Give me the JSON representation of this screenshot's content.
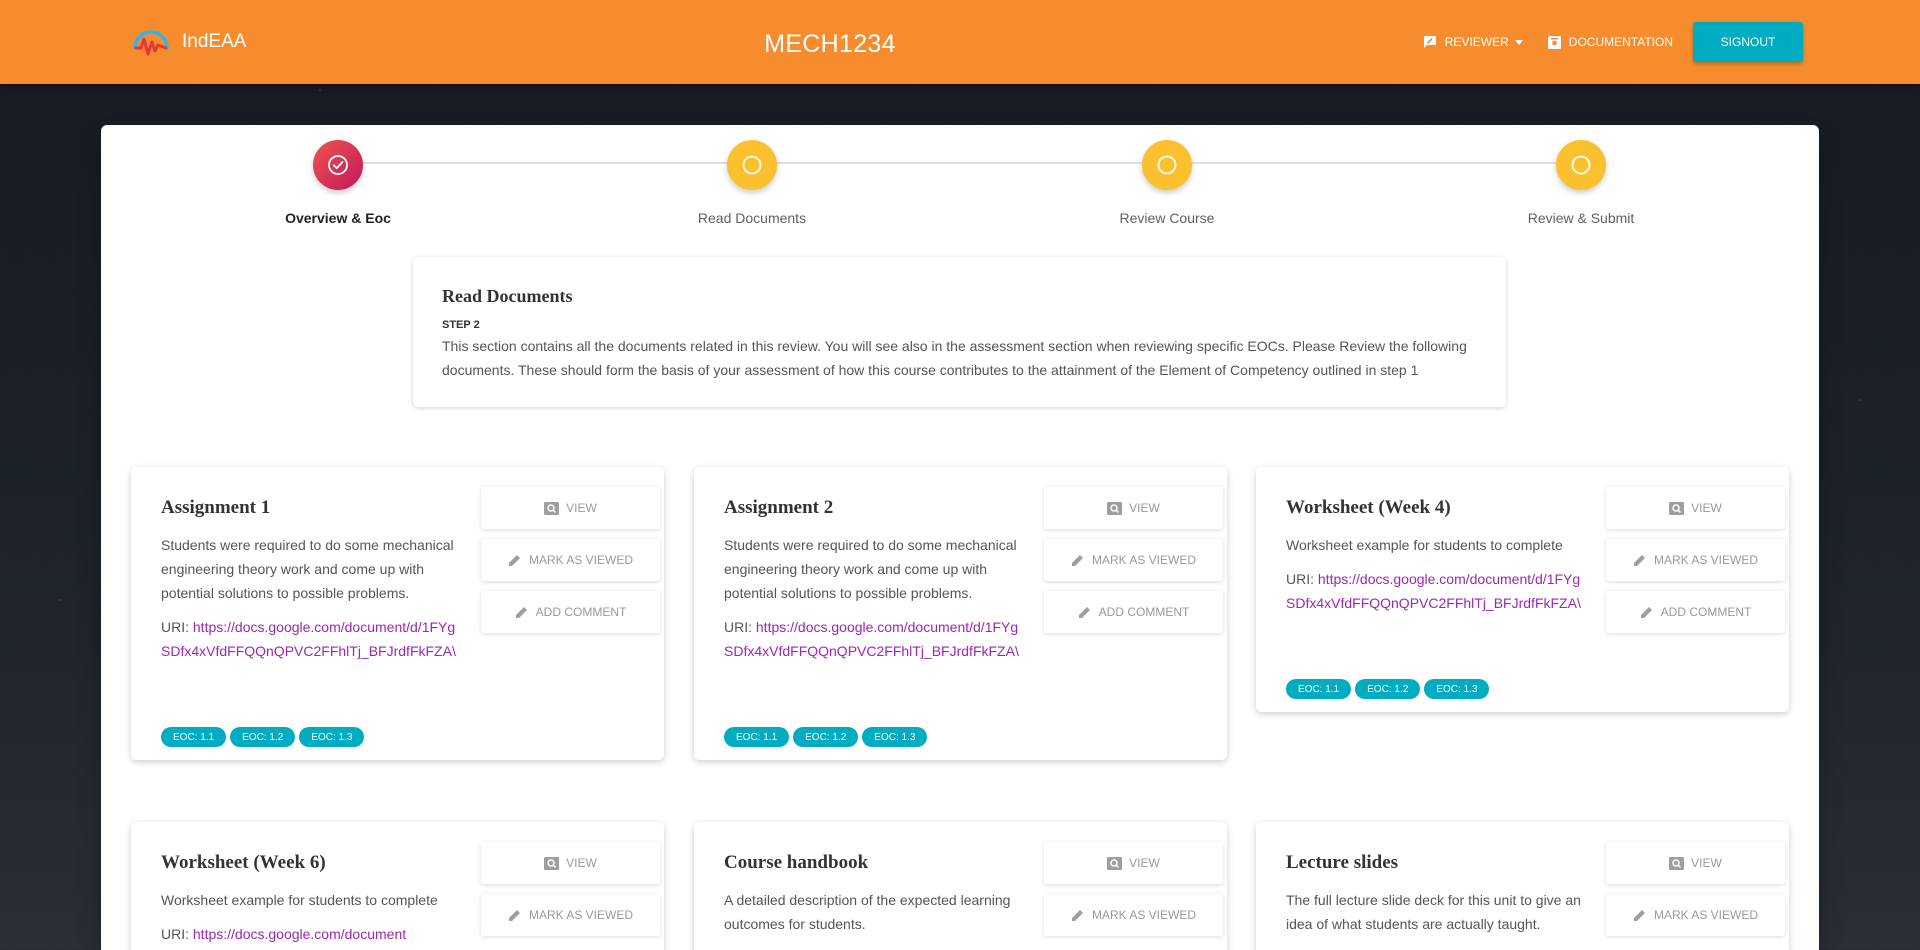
{
  "navbar": {
    "brand": "IndEAA",
    "title": "MECH1234",
    "reviewer_label": "REVIEWER",
    "documentation_label": "DOCUMENTATION",
    "signout_label": "SIGNOUT"
  },
  "stepper": {
    "steps": [
      {
        "label": "Overview & Eoc",
        "status": "done"
      },
      {
        "label": "Read Documents",
        "status": "todo"
      },
      {
        "label": "Review Course",
        "status": "todo"
      },
      {
        "label": "Review & Submit",
        "status": "todo"
      }
    ]
  },
  "info": {
    "title": "Read Documents",
    "step": "STEP 2",
    "text": "This section contains all the documents related in this review. You will see also in the assessment section when reviewing specific EOCs. Please Review the following documents. These should form the basis of your assessment of how this course contributes to the attainment of the Element of Competency outlined in step 1"
  },
  "actions": {
    "view": "VIEW",
    "mark": "MARK AS VIEWED",
    "comment": "ADD COMMENT"
  },
  "documents": [
    {
      "title": "Assignment 1",
      "description": "Students were required to do some mechanical engineering theory work and come up with potential solutions to possible problems.",
      "uri_label": "URI:",
      "uri": "https://docs.google.com/document/d/1FYgSDfx4xVfdFFQQnQPVC2FFhlTj_BFJrdfFkFZA\\",
      "eocs": [
        "EOC: 1.1",
        "EOC: 1.2",
        "EOC: 1.3"
      ]
    },
    {
      "title": "Assignment 2",
      "description": "Students were required to do some mechanical engineering theory work and come up with potential solutions to possible problems.",
      "uri_label": "URI:",
      "uri": "https://docs.google.com/document/d/1FYgSDfx4xVfdFFQQnQPVC2FFhlTj_BFJrdfFkFZA\\",
      "eocs": [
        "EOC: 1.1",
        "EOC: 1.2",
        "EOC: 1.3"
      ]
    },
    {
      "title": "Worksheet (Week 4)",
      "description": "Worksheet example for students to complete",
      "uri_label": "URI:",
      "uri": "https://docs.google.com/document/d/1FYgSDfx4xVfdFFQQnQPVC2FFhlTj_BFJrdfFkFZA\\",
      "eocs": [
        "EOC: 1.1",
        "EOC: 1.2",
        "EOC: 1.3"
      ]
    },
    {
      "title": "Worksheet (Week 6)",
      "description": "Worksheet example for students to complete",
      "uri_label": "URI:",
      "uri": "https://docs.google.com/document"
    },
    {
      "title": "Course handbook",
      "description": "A detailed description of the expected learning outcomes for students."
    },
    {
      "title": "Lecture slides",
      "description": "The full lecture slide deck for this unit to give an idea of what students are actually taught."
    }
  ]
}
